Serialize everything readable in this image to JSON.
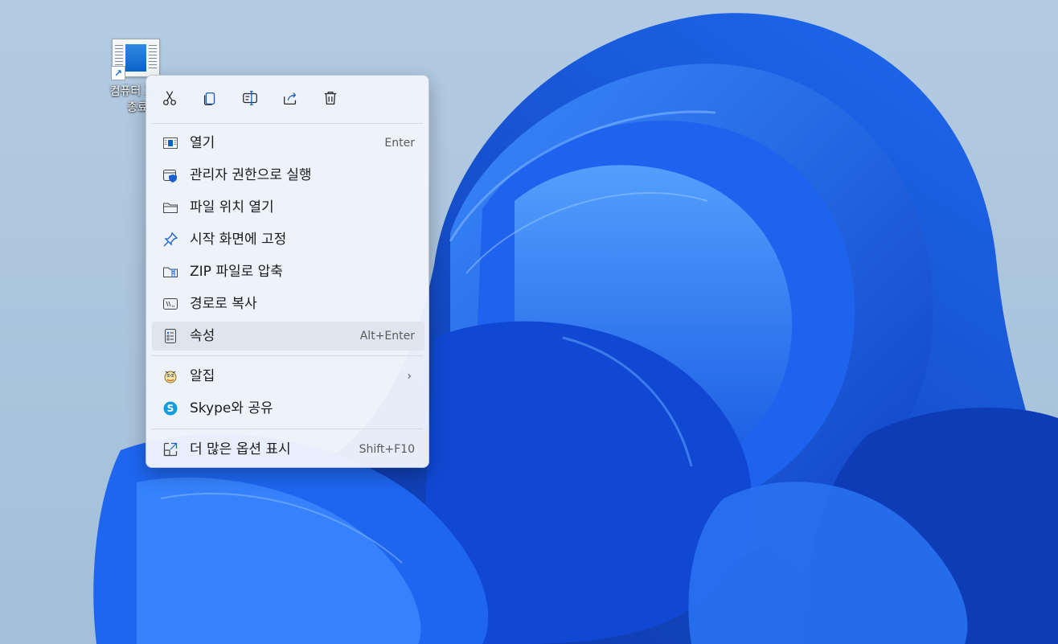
{
  "desktop": {
    "shortcut": {
      "label_line1": "컴퓨터 끄기",
      "label_line2": "종료"
    }
  },
  "toolbar": {
    "cut_icon": "scissors-icon",
    "copy_icon": "copy-icon",
    "rename_icon": "rename-icon",
    "share_icon": "share-icon",
    "delete_icon": "trash-icon"
  },
  "menu": {
    "items": [
      {
        "label": "열기",
        "shortcut": "Enter",
        "icon": "window-icon"
      },
      {
        "label": "관리자 권한으로 실행",
        "shortcut": "",
        "icon": "shield-icon"
      },
      {
        "label": "파일 위치 열기",
        "shortcut": "",
        "icon": "folder-icon"
      },
      {
        "label": "시작 화면에 고정",
        "shortcut": "",
        "icon": "pin-icon"
      },
      {
        "label": "ZIP 파일로 압축",
        "shortcut": "",
        "icon": "zip-folder-icon"
      },
      {
        "label": "경로로 복사",
        "shortcut": "",
        "icon": "path-icon"
      },
      {
        "label": "속성",
        "shortcut": "Alt+Enter",
        "icon": "properties-icon"
      },
      {
        "label": "알집",
        "shortcut": "",
        "icon": "alzip-icon",
        "submenu": true
      },
      {
        "label": "Skype와 공유",
        "shortcut": "",
        "icon": "skype-icon"
      },
      {
        "label": "더 많은 옵션 표시",
        "shortcut": "Shift+F10",
        "icon": "more-options-icon"
      }
    ]
  },
  "colors": {
    "accent": "#0a63c9",
    "wallpaper": "#1a5fe0",
    "menu_bg": "#f0f4fb"
  }
}
